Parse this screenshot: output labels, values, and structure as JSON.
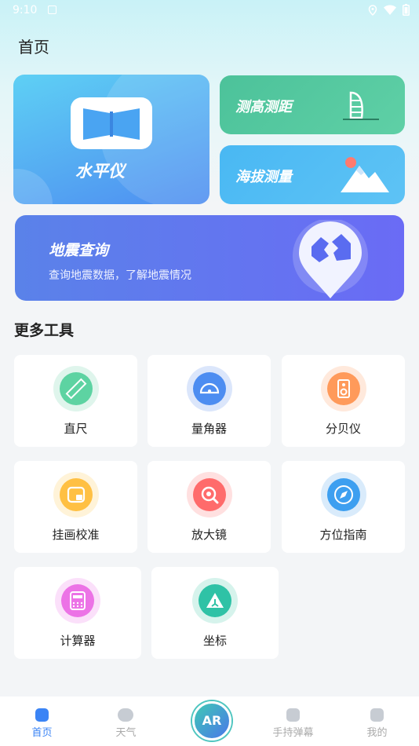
{
  "status_bar": {
    "time": "9:10"
  },
  "page_title": "首页",
  "cards": {
    "level": "水平仪",
    "height": "测高测距",
    "altitude": "海拔测量",
    "earthquake": {
      "title": "地震查询",
      "desc": "查询地震数据，了解地震情况"
    }
  },
  "section_title": "更多工具",
  "tools": [
    {
      "label": "直尺",
      "icon": "ruler-icon",
      "color": "#5dd3a2"
    },
    {
      "label": "量角器",
      "icon": "protractor-icon",
      "color": "#4d8df1"
    },
    {
      "label": "分贝仪",
      "icon": "speaker-icon",
      "color": "#ff9a5a"
    },
    {
      "label": "挂画校准",
      "icon": "frame-icon",
      "color": "#ffc043"
    },
    {
      "label": "放大镜",
      "icon": "magnifier-icon",
      "color": "#ff6b6b"
    },
    {
      "label": "方位指南",
      "icon": "compass-icon",
      "color": "#3d9ff0"
    },
    {
      "label": "计算器",
      "icon": "calculator-icon",
      "color": "#ec73e6"
    },
    {
      "label": "坐标",
      "icon": "coordinate-icon",
      "color": "#2fc2a6"
    }
  ],
  "tabbar": {
    "home": "首页",
    "weather": "天气",
    "ar": "AR",
    "barrage": "手持弹幕",
    "mine": "我的",
    "active_color": "#3b84f5"
  }
}
